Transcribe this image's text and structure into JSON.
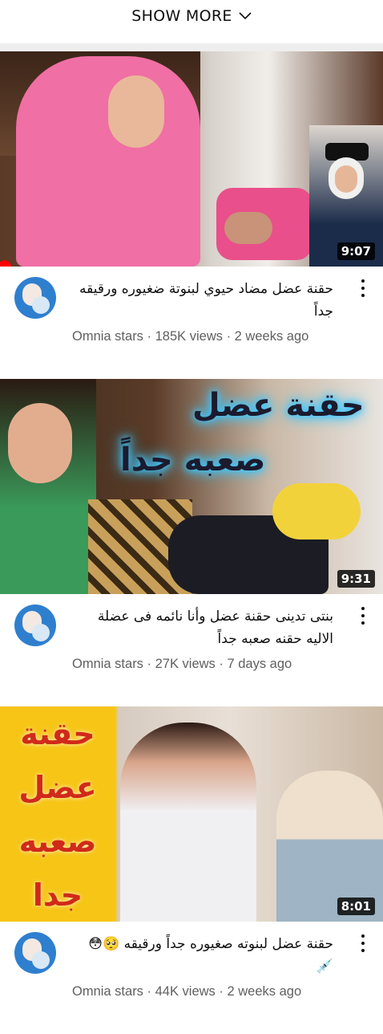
{
  "show_more": {
    "label": "SHOW MORE"
  },
  "videos": [
    {
      "duration": "9:07",
      "title": "حقنة عضل مضاد حيوي لبنوتة ضغيوره ورقيقه جداً",
      "channel": "Omnia stars",
      "views": "185K views",
      "age": "2 weeks ago"
    },
    {
      "duration": "9:31",
      "overlay_line1": "حقنة عضل",
      "overlay_line2": "صعبه جداً",
      "title": "بنتى تدينى حقنة عضل وأنا نائمه فى عضلة الاليه حقنه صعبه جداً",
      "channel": "Omnia stars",
      "views": "27K views",
      "age": "7 days ago"
    },
    {
      "duration": "8:01",
      "overlay_words": [
        "حقنة",
        "عضل",
        "صعبه",
        "جدا"
      ],
      "title": "حقنة عضل لبنوته صغيوره جداً ورقيقه 🥺😳💉",
      "channel": "Omnia stars",
      "views": "44K views",
      "age": "2 weeks ago"
    }
  ],
  "sub_separator": " · "
}
